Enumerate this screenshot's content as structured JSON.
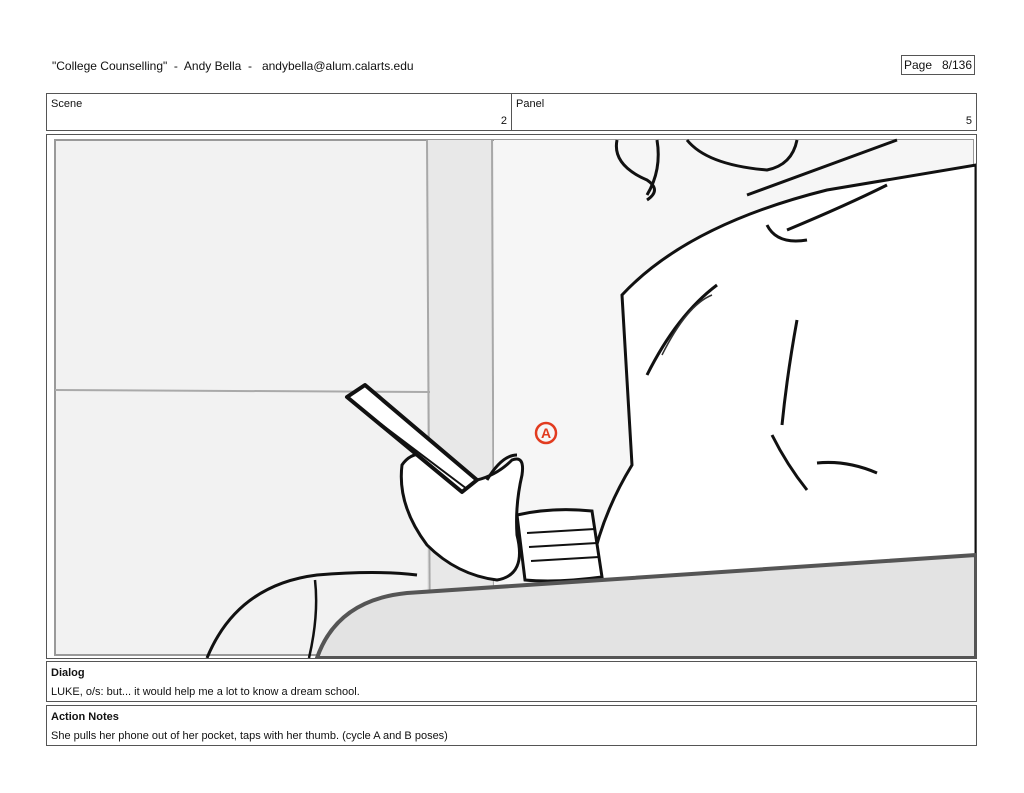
{
  "header": {
    "title": "\"College Counselling\"  -  Andy Bella  -   andybella@alum.calarts.edu",
    "page": "Page   8/136"
  },
  "scene": {
    "label": "Scene",
    "value": "2"
  },
  "panel": {
    "label": "Panel",
    "value": "5"
  },
  "annotation_mark": "A",
  "annotation_color": "#e23b1f",
  "dialog": {
    "title": "Dialog",
    "text": "LUKE, o/s: but... it would help me a lot to know a dream school."
  },
  "action_notes": {
    "title": "Action Notes",
    "text": "She pulls her phone out of her pocket, taps with her thumb. (cycle A and B poses)"
  }
}
